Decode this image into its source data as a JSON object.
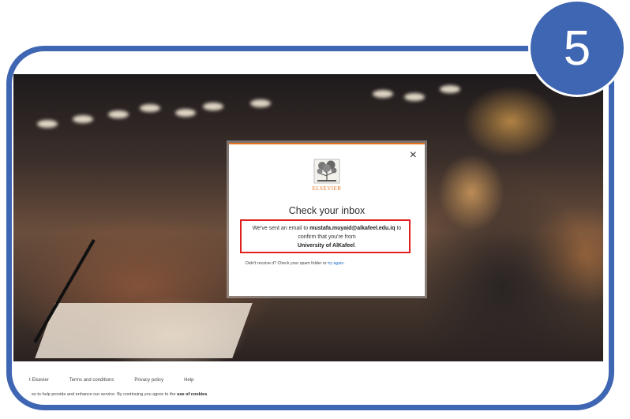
{
  "step_badge": "5",
  "dialog": {
    "logo_text": "ELSEVIER",
    "close_icon": "×",
    "title": "Check your inbox",
    "msg_prefix": "We've sent an email to ",
    "email": "mustafa.muyaid@alkafeel.edu.iq",
    "msg_middle": " to confirm that you're from ",
    "institution": "University of AlKafeel",
    "msg_suffix": ".",
    "spam_text": "Didn't receive it? Check your spam folder or ",
    "try_again": "try again",
    "spam_suffix": "."
  },
  "footer": {
    "links": [
      "t Elsevier",
      "Terms and conditions",
      "Privacy policy",
      "Help"
    ],
    "cookie_prefix": "es to help provide and enhance our service. By continuing you agree to the ",
    "cookie_link": "use of cookies",
    "cookie_suffix": "."
  },
  "colors": {
    "frame_blue": "#3f66b2",
    "elsevier_orange": "#e9711c",
    "highlight_red": "#e0201f",
    "link_blue": "#1f70c1"
  }
}
